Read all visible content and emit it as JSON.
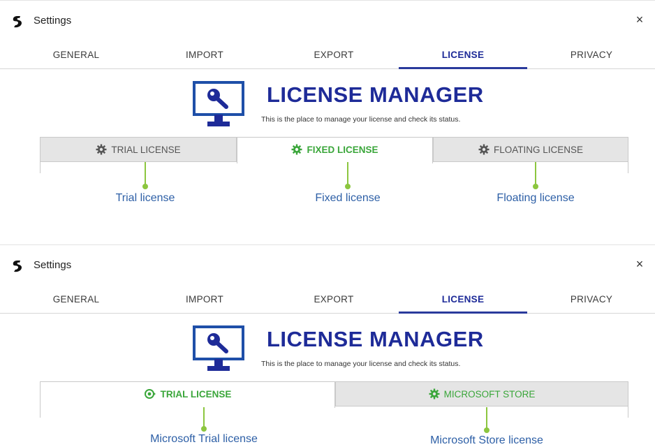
{
  "panels": [
    {
      "title": "Settings",
      "close_symbol": "×",
      "tabs": [
        "GENERAL",
        "IMPORT",
        "EXPORT",
        "LICENSE",
        "PRIVACY"
      ],
      "active_tab": "LICENSE",
      "manager_title": "LICENSE MANAGER",
      "manager_subtitle": "This is the place to manage your license and check its status.",
      "subtabs": [
        {
          "label": "TRIAL LICENSE",
          "icon": "gear-icon",
          "active": false
        },
        {
          "label": "FIXED LICENSE",
          "icon": "gear-icon",
          "active": true
        },
        {
          "label": "FLOATING LICENSE",
          "icon": "gear-icon",
          "active": false
        }
      ],
      "callouts": [
        "Trial license",
        "Fixed license",
        "Floating license"
      ]
    },
    {
      "title": "Settings",
      "close_symbol": "×",
      "tabs": [
        "GENERAL",
        "IMPORT",
        "EXPORT",
        "LICENSE",
        "PRIVACY"
      ],
      "active_tab": "LICENSE",
      "manager_title": "LICENSE MANAGER",
      "manager_subtitle": "This is the place to manage your license and check its status.",
      "subtabs": [
        {
          "label": "TRIAL LICENSE",
          "icon": "trial-icon",
          "active": true
        },
        {
          "label": "MICROSOFT STORE",
          "icon": "gear-icon",
          "active": false
        }
      ],
      "callouts": [
        "Microsoft Trial license",
        "Microsoft Store license"
      ]
    }
  ],
  "colors": {
    "brand_blue": "#1e2b98",
    "active_green": "#3aa63a",
    "callout_green": "#8cc63f",
    "callout_text": "#2d5fa6",
    "inactive_tab_bg": "#e5e5e5"
  }
}
